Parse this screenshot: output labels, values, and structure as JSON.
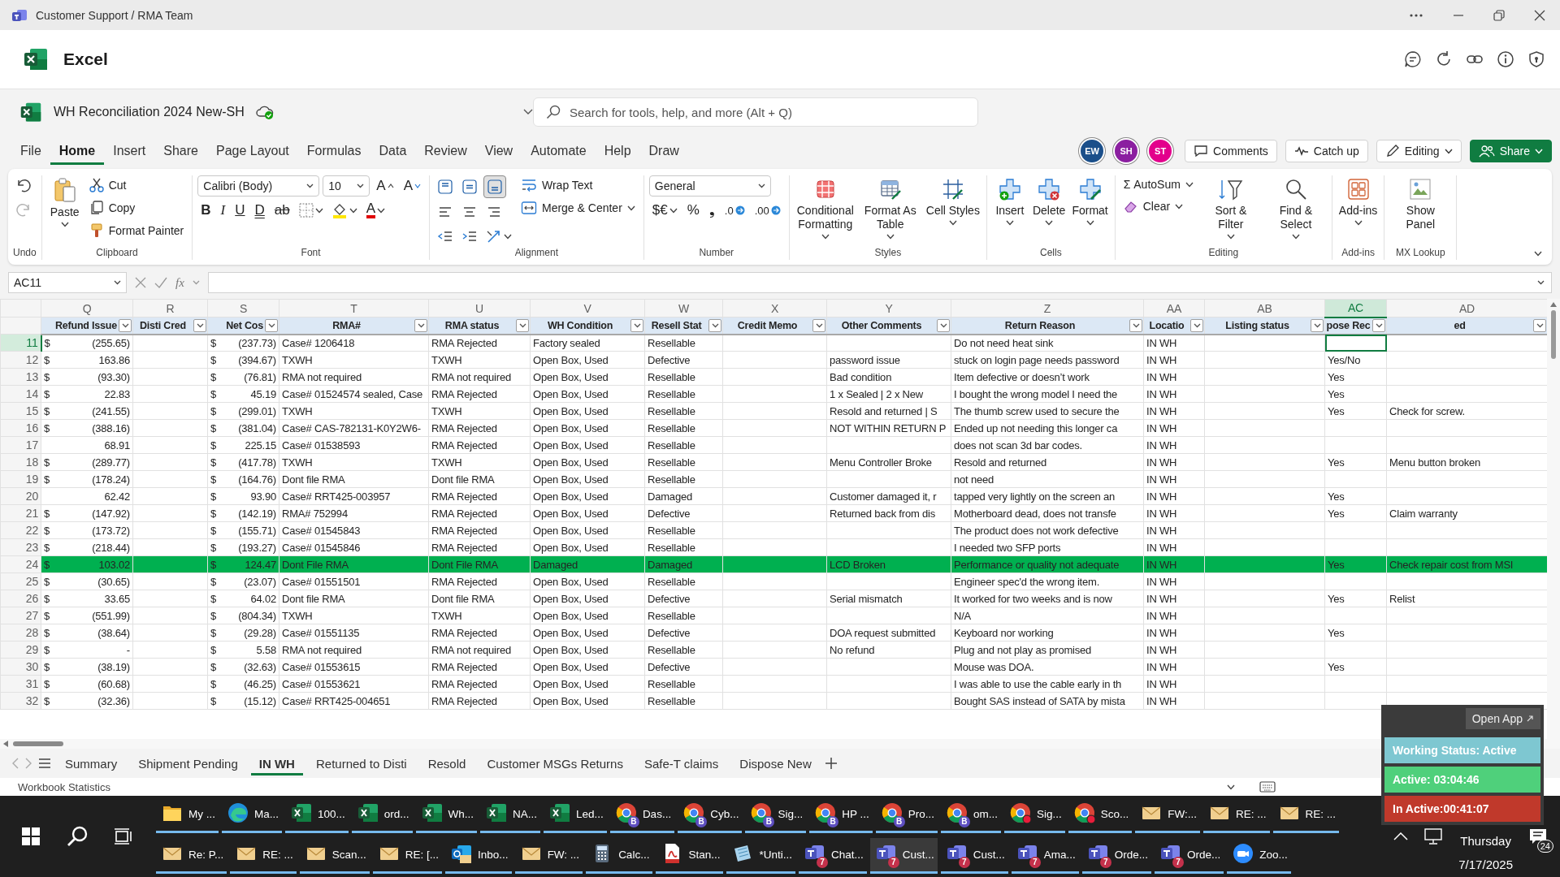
{
  "title_bar": {
    "title": "Customer Support / RMA Team"
  },
  "app_header": {
    "app_name": "Excel"
  },
  "document": {
    "name": "WH Reconciliation 2024 New-SH",
    "search": {
      "placeholder": "Search for tools, help, and more (Alt + Q)"
    }
  },
  "menu_tabs": [
    {
      "label": "File",
      "selected": false
    },
    {
      "label": "Home",
      "selected": true
    },
    {
      "label": "Insert",
      "selected": false
    },
    {
      "label": "Share",
      "selected": false
    },
    {
      "label": "Page Layout",
      "selected": false
    },
    {
      "label": "Formulas",
      "selected": false
    },
    {
      "label": "Data",
      "selected": false
    },
    {
      "label": "Review",
      "selected": false
    },
    {
      "label": "View",
      "selected": false
    },
    {
      "label": "Automate",
      "selected": false
    },
    {
      "label": "Help",
      "selected": false
    },
    {
      "label": "Draw",
      "selected": false
    }
  ],
  "collaborators": [
    {
      "initials": "EW",
      "color": "#1b4f8a"
    },
    {
      "initials": "SH",
      "color": "#8b1fa0"
    },
    {
      "initials": "ST",
      "color": "#e3008c"
    }
  ],
  "header_buttons": [
    {
      "label": "Comments",
      "kind": "comments"
    },
    {
      "label": "Catch up",
      "kind": "catchup"
    },
    {
      "label": "Editing",
      "kind": "editing"
    },
    {
      "label": "Share",
      "kind": "share"
    }
  ],
  "ribbon": {
    "groups": [
      {
        "label": "Undo",
        "columns": [
          [
            {
              "kind": "icon",
              "disabled": false
            },
            {
              "kind": "icon",
              "disabled": true
            }
          ]
        ]
      },
      {
        "label": "Clipboard",
        "columns": [
          [
            {
              "kind": "large",
              "label": "Paste",
              "dropdown": true
            }
          ],
          [
            {
              "kind": "small",
              "label": "Cut"
            },
            {
              "kind": "small",
              "label": "Copy"
            },
            {
              "kind": "small",
              "label": "Format Painter"
            }
          ]
        ]
      },
      {
        "label": "Font",
        "columns": [
          [
            {
              "kind": "line",
              "items": [
                {
                  "kind": "select",
                  "value": "Calibri (Body)"
                },
                {
                  "kind": "select",
                  "value": "10"
                },
                {
                  "kind": "glyph",
                  "label": "A"
                },
                {
                  "kind": "glyph",
                  "label": "A"
                }
              ]
            },
            {
              "kind": "line",
              "items": [
                {
                  "kind": "glyph",
                  "label": "B"
                },
                {
                  "kind": "glyph",
                  "label": "I"
                },
                {
                  "kind": "glyph",
                  "label": "U"
                },
                {
                  "kind": "glyph",
                  "label": "D"
                },
                {
                  "kind": "glyph",
                  "label": "ab"
                },
                {
                  "kind": "icon",
                  "dropdown": true
                },
                {
                  "kind": "icon",
                  "dropdown": true
                },
                {
                  "kind": "glyph",
                  "label": "A",
                  "dropdown": true
                }
              ]
            }
          ]
        ]
      },
      {
        "label": "Alignment",
        "columns": [
          [
            {
              "kind": "line",
              "items": [
                {
                  "kind": "icon",
                  "selected": false
                },
                {
                  "kind": "icon",
                  "selected": false
                },
                {
                  "kind": "icon",
                  "selected": true
                }
              ]
            },
            {
              "kind": "line",
              "items": [
                {
                  "kind": "icon"
                },
                {
                  "kind": "icon"
                },
                {
                  "kind": "icon"
                }
              ]
            },
            {
              "kind": "line",
              "items": [
                {
                  "kind": "icon"
                },
                {
                  "kind": "icon"
                },
                {
                  "kind": "icon",
                  "dropdown": true
                }
              ]
            }
          ],
          [
            {
              "kind": "small",
              "label": "Wrap Text"
            },
            {
              "kind": "small",
              "label": "Merge & Center",
              "dropdown": true
            }
          ]
        ]
      },
      {
        "label": "Number",
        "columns": [
          [
            {
              "kind": "select",
              "value": "General"
            },
            {
              "kind": "line",
              "items": [
                {
                  "kind": "glyph",
                  "label": "$€",
                  "dropdown": true
                },
                {
                  "kind": "glyph",
                  "label": "%"
                },
                {
                  "kind": "glyph",
                  "label": "❟"
                },
                {
                  "kind": "glyph",
                  "label": ".0"
                },
                {
                  "kind": "glyph",
                  "label": ".00"
                }
              ]
            }
          ]
        ]
      },
      {
        "label": "Styles",
        "columns": [
          [
            {
              "kind": "large",
              "label": "Conditional Formatting",
              "dropdown": true
            }
          ],
          [
            {
              "kind": "large",
              "label": "Format As Table",
              "dropdown": true
            }
          ],
          [
            {
              "kind": "large",
              "label": "Cell Styles",
              "dropdown": true
            }
          ]
        ]
      },
      {
        "label": "Cells",
        "columns": [
          [
            {
              "kind": "large",
              "label": "Insert",
              "dropdown": true
            }
          ],
          [
            {
              "kind": "large",
              "label": "Delete",
              "dropdown": true
            }
          ],
          [
            {
              "kind": "large",
              "label": "Format",
              "dropdown": true
            }
          ]
        ]
      },
      {
        "label": "Editing",
        "columns": [
          [
            {
              "kind": "small",
              "label": "AutoSum",
              "glyph": "Σ",
              "dropdown": true
            },
            {
              "kind": "small",
              "label": "Clear",
              "dropdown": true
            }
          ],
          [
            {
              "kind": "large",
              "label": "Sort & Filter",
              "dropdown": true
            }
          ],
          [
            {
              "kind": "large",
              "label": "Find & Select",
              "dropdown": true
            }
          ]
        ]
      },
      {
        "label": "Add-ins",
        "columns": [
          [
            {
              "kind": "large",
              "label": "Add-ins",
              "dropdown": true
            }
          ]
        ]
      },
      {
        "label": "MX Lookup",
        "columns": [
          [
            {
              "kind": "large",
              "label": "Show Panel"
            }
          ]
        ]
      }
    ]
  },
  "formula_bar": {
    "name_box": "AC11",
    "function_label": "fx"
  },
  "sheet": {
    "columns": [
      {
        "letter": "Q",
        "header": "Refund Issue",
        "kind": "money",
        "selected": false
      },
      {
        "letter": "R",
        "header": "Disti Cred",
        "kind": "text",
        "selected": false
      },
      {
        "letter": "S",
        "header": "Net Cos",
        "kind": "money",
        "selected": false
      },
      {
        "letter": "T",
        "header": "RMA#",
        "kind": "text",
        "selected": false
      },
      {
        "letter": "U",
        "header": "RMA status",
        "kind": "text",
        "selected": false
      },
      {
        "letter": "V",
        "header": "WH Condition",
        "kind": "text",
        "selected": false
      },
      {
        "letter": "W",
        "header": "Resell Stat",
        "kind": "text",
        "selected": false
      },
      {
        "letter": "X",
        "header": "Credit Memo",
        "kind": "text",
        "selected": false
      },
      {
        "letter": "Y",
        "header": "Other Comments",
        "kind": "text",
        "selected": false
      },
      {
        "letter": "Z",
        "header": "Return Reason",
        "kind": "text",
        "selected": false
      },
      {
        "letter": "AA",
        "header": "Locatio",
        "kind": "text",
        "selected": false
      },
      {
        "letter": "AB",
        "header": "Listing status",
        "kind": "text",
        "selected": false
      },
      {
        "letter": "AC",
        "header": "pose Rec",
        "kind": "text",
        "selected": true
      },
      {
        "letter": "AD",
        "header": "ed",
        "kind": "text",
        "selected": false
      }
    ],
    "rows": [
      {
        "number": "11",
        "selected": true,
        "highlight": false,
        "cells": [
          {
            "sign": "$",
            "value": "(255.65)"
          },
          null,
          {
            "sign": "$",
            "value": "(237.73)"
          },
          "Case# 1206418",
          "RMA Rejected",
          "Factory sealed",
          "Resellable",
          null,
          null,
          "Do not need heat sink",
          "IN WH",
          null,
          null,
          null
        ]
      },
      {
        "number": "12",
        "selected": false,
        "highlight": false,
        "cells": [
          {
            "sign": "$",
            "value": "163.86"
          },
          null,
          {
            "sign": "$",
            "value": "(394.67)"
          },
          "TXWH",
          "TXWH",
          "Open Box, Used",
          "Defective",
          null,
          "password issue",
          "stuck on login page needs password",
          "IN WH",
          null,
          "Yes/No",
          null
        ]
      },
      {
        "number": "13",
        "selected": false,
        "highlight": false,
        "cells": [
          {
            "sign": "$",
            "value": "(93.30)"
          },
          null,
          {
            "sign": "$",
            "value": "(76.81)"
          },
          "RMA not required",
          "RMA not required",
          "Open Box, Used",
          "Resellable",
          null,
          "Bad condition",
          "Item defective or doesn’t work",
          "IN WH",
          null,
          "Yes",
          null
        ]
      },
      {
        "number": "14",
        "selected": false,
        "highlight": false,
        "cells": [
          {
            "sign": "$",
            "value": "22.83"
          },
          null,
          {
            "sign": "$",
            "value": "45.19"
          },
          "Case# 01524574 sealed, Case",
          "RMA Rejected",
          "Open Box, Used",
          "Resellable",
          null,
          "1 x Sealed | 2 x New",
          "I bought the wrong model I need the",
          "IN WH",
          null,
          "Yes",
          null
        ]
      },
      {
        "number": "15",
        "selected": false,
        "highlight": false,
        "cells": [
          {
            "sign": "$",
            "value": "(241.55)"
          },
          null,
          {
            "sign": "$",
            "value": "(299.01)"
          },
          "TXWH",
          "TXWH",
          "Open Box, Used",
          "Resellable",
          null,
          "Resold and returned | S",
          "The thumb screw used to secure the",
          "IN WH",
          null,
          "Yes",
          "Check for screw."
        ]
      },
      {
        "number": "16",
        "selected": false,
        "highlight": false,
        "cells": [
          {
            "sign": "$",
            "value": "(388.16)"
          },
          null,
          {
            "sign": "$",
            "value": "(381.04)"
          },
          "Case# CAS-782131-K0Y2W6-",
          "RMA Rejected",
          "Open Box, Used",
          "Resellable",
          null,
          "NOT WITHIN RETURN P",
          "Ended up not needing this longer ca",
          "IN WH",
          null,
          null,
          null
        ]
      },
      {
        "number": "17",
        "selected": false,
        "highlight": false,
        "cells": [
          {
            "value": "68.91"
          },
          null,
          {
            "sign": "$",
            "value": "225.15"
          },
          "Case# 01538593",
          "RMA Rejected",
          "Open Box, Used",
          "Resellable",
          null,
          null,
          "does not scan 3d bar codes.",
          "IN WH",
          null,
          null,
          null
        ]
      },
      {
        "number": "18",
        "selected": false,
        "highlight": false,
        "cells": [
          {
            "sign": "$",
            "value": "(289.77)"
          },
          null,
          {
            "sign": "$",
            "value": "(417.78)"
          },
          "TXWH",
          "TXWH",
          "Open Box, Used",
          "Resellable",
          null,
          "Menu Controller Broke",
          "Resold and returned",
          "IN WH",
          null,
          "Yes",
          "Menu button broken"
        ]
      },
      {
        "number": "19",
        "selected": false,
        "highlight": false,
        "cells": [
          {
            "sign": "$",
            "value": "(178.24)"
          },
          null,
          {
            "sign": "$",
            "value": "(164.76)"
          },
          "Dont file RMA",
          "Dont file RMA",
          "Open Box, Used",
          "Resellable",
          null,
          null,
          "not need",
          "IN WH",
          null,
          null,
          null
        ]
      },
      {
        "number": "20",
        "selected": false,
        "highlight": false,
        "cells": [
          {
            "value": "62.42"
          },
          null,
          {
            "sign": "$",
            "value": "93.90"
          },
          "Case# RRT425-003957",
          "RMA Rejected",
          "Open Box, Used",
          "Damaged",
          null,
          "Customer damaged it, r",
          "tapped very lightly on the screen an",
          "IN WH",
          null,
          "Yes",
          null
        ]
      },
      {
        "number": "21",
        "selected": false,
        "highlight": false,
        "cells": [
          {
            "sign": "$",
            "value": "(147.92)"
          },
          null,
          {
            "sign": "$",
            "value": "(142.19)"
          },
          "RMA# 752994",
          "RMA Rejected",
          "Open Box, Used",
          "Defective",
          null,
          "Returned back from dis",
          "Motherboard dead, does not transfe",
          "IN WH",
          null,
          "Yes",
          "Claim warranty"
        ]
      },
      {
        "number": "22",
        "selected": false,
        "highlight": false,
        "cells": [
          {
            "sign": "$",
            "value": "(173.72)"
          },
          null,
          {
            "sign": "$",
            "value": "(155.71)"
          },
          "Case# 01545843",
          "RMA Rejected",
          "Open Box, Used",
          "Resellable",
          null,
          null,
          "The product does not work defective",
          "IN WH",
          null,
          null,
          null
        ]
      },
      {
        "number": "23",
        "selected": false,
        "highlight": false,
        "cells": [
          {
            "sign": "$",
            "value": "(218.44)"
          },
          null,
          {
            "sign": "$",
            "value": "(193.27)"
          },
          "Case# 01545846",
          "RMA Rejected",
          "Open Box, Used",
          "Resellable",
          null,
          null,
          "I needed two SFP ports",
          "IN WH",
          null,
          null,
          null
        ]
      },
      {
        "number": "24",
        "selected": false,
        "highlight": true,
        "cells": [
          {
            "sign": "$",
            "value": "103.02"
          },
          null,
          {
            "sign": "$",
            "value": "124.47"
          },
          "Dont File RMA",
          "Dont File RMA",
          "Damaged",
          "Damaged",
          null,
          "LCD Broken",
          "Performance or quality not adequate",
          "IN WH",
          null,
          "Yes",
          "Check repair cost from MSI"
        ]
      },
      {
        "number": "25",
        "selected": false,
        "highlight": false,
        "cells": [
          {
            "sign": "$",
            "value": "(30.65)"
          },
          null,
          {
            "sign": "$",
            "value": "(23.07)"
          },
          "Case# 01551501",
          "RMA Rejected",
          "Open Box, Used",
          "Resellable",
          null,
          null,
          "Engineer spec'd the wrong item.",
          "IN WH",
          null,
          null,
          null
        ]
      },
      {
        "number": "26",
        "selected": false,
        "highlight": false,
        "cells": [
          {
            "sign": "$",
            "value": "33.65"
          },
          null,
          {
            "sign": "$",
            "value": "64.02"
          },
          "Dont file RMA",
          "Dont file RMA",
          "Open Box, Used",
          "Defective",
          null,
          "Serial mismatch",
          "It worked for two weeks and is now",
          "IN WH",
          null,
          "Yes",
          "Relist"
        ]
      },
      {
        "number": "27",
        "selected": false,
        "highlight": false,
        "cells": [
          {
            "sign": "$",
            "value": "(551.99)"
          },
          null,
          {
            "sign": "$",
            "value": "(804.34)"
          },
          "TXWH",
          "TXWH",
          "Open Box, Used",
          "Resellable",
          null,
          null,
          "N/A",
          "IN WH",
          null,
          null,
          null
        ]
      },
      {
        "number": "28",
        "selected": false,
        "highlight": false,
        "cells": [
          {
            "sign": "$",
            "value": "(38.64)"
          },
          null,
          {
            "sign": "$",
            "value": "(29.28)"
          },
          "Case# 01551135",
          "RMA Rejected",
          "Open Box, Used",
          "Defective",
          null,
          "DOA request submitted",
          "Keyboard nor working",
          "IN WH",
          null,
          "Yes",
          null
        ]
      },
      {
        "number": "29",
        "selected": false,
        "highlight": false,
        "cells": [
          {
            "sign": "$",
            "value": "-"
          },
          null,
          {
            "sign": "$",
            "value": "5.58"
          },
          "RMA not required",
          "RMA not required",
          "Open Box, Used",
          "Resellable",
          null,
          "No refund",
          "Plug and not play as promised",
          "IN WH",
          null,
          null,
          null
        ]
      },
      {
        "number": "30",
        "selected": false,
        "highlight": false,
        "cells": [
          {
            "sign": "$",
            "value": "(38.19)"
          },
          null,
          {
            "sign": "$",
            "value": "(32.63)"
          },
          "Case# 01553615",
          "RMA Rejected",
          "Open Box, Used",
          "Defective",
          null,
          null,
          "Mouse was DOA.",
          "IN WH",
          null,
          "Yes",
          null
        ]
      },
      {
        "number": "31",
        "selected": false,
        "highlight": false,
        "cells": [
          {
            "sign": "$",
            "value": "(60.68)"
          },
          null,
          {
            "sign": "$",
            "value": "(46.25)"
          },
          "Case# 01553621",
          "RMA Rejected",
          "Open Box, Used",
          "Resellable",
          null,
          null,
          "I was able to use the cable early in th",
          "IN WH",
          null,
          null,
          null
        ]
      },
      {
        "number": "32",
        "selected": false,
        "highlight": false,
        "cells": [
          {
            "sign": "$",
            "value": "(32.36)"
          },
          null,
          {
            "sign": "$",
            "value": "(15.12)"
          },
          "Case# RRT425-004651",
          "RMA Rejected",
          "Open Box, Used",
          "Resellable",
          null,
          null,
          "Bought SAS instead of SATA by mista",
          "IN WH",
          null,
          null,
          null
        ]
      }
    ]
  },
  "sheet_tabs": [
    {
      "label": "Summary",
      "selected": false
    },
    {
      "label": "Shipment Pending",
      "selected": false
    },
    {
      "label": "IN WH",
      "selected": true
    },
    {
      "label": "Returned to Disti",
      "selected": false
    },
    {
      "label": "Resold",
      "selected": false
    },
    {
      "label": "Customer MSGs Returns",
      "selected": false
    },
    {
      "label": "Safe-T claims",
      "selected": false
    },
    {
      "label": "Dispose New",
      "selected": false
    }
  ],
  "status_bar": {
    "text": "Workbook Statistics"
  },
  "overlay": {
    "button": "Open App",
    "status": "Working Status: Active",
    "active": "Active: 03:04:46",
    "inactive": "In Active:00:41:07"
  },
  "taskbar": {
    "top_row": [
      {
        "label": "My ...",
        "kind": "folder",
        "selected": false
      },
      {
        "label": "Ma...",
        "kind": "edge",
        "selected": false
      },
      {
        "label": "100...",
        "kind": "excel",
        "selected": false
      },
      {
        "label": "ord...",
        "kind": "excel",
        "selected": false
      },
      {
        "label": "Wh...",
        "kind": "excel",
        "selected": false
      },
      {
        "label": "NA...",
        "kind": "excel",
        "selected": false
      },
      {
        "label": "Led...",
        "kind": "excel",
        "selected": false
      },
      {
        "label": "Das...",
        "kind": "chrome",
        "badge": "B",
        "selected": false
      },
      {
        "label": "Cyb...",
        "kind": "chrome",
        "badge": "B",
        "selected": false
      },
      {
        "label": "Sig...",
        "kind": "chrome",
        "badge": "B",
        "selected": false
      },
      {
        "label": "HP ...",
        "kind": "chrome",
        "badge": "B",
        "selected": false
      },
      {
        "label": "Pro...",
        "kind": "chrome",
        "badge": "B",
        "selected": false
      },
      {
        "label": "om...",
        "kind": "chrome",
        "badge": "B",
        "selected": false
      },
      {
        "label": "Sig...",
        "kind": "chrome-alert",
        "selected": false
      },
      {
        "label": "Sco...",
        "kind": "chrome-alert",
        "selected": false
      },
      {
        "label": "FW:...",
        "kind": "mail",
        "selected": false
      },
      {
        "label": "RE: ...",
        "kind": "mail",
        "selected": false
      },
      {
        "label": "RE: ...",
        "kind": "mail",
        "selected": false
      }
    ],
    "bottom_row": [
      {
        "label": "Re: P...",
        "kind": "mail",
        "selected": false
      },
      {
        "label": "RE: ...",
        "kind": "mail",
        "selected": false
      },
      {
        "label": "Scan...",
        "kind": "mail",
        "selected": false
      },
      {
        "label": "RE: [...",
        "kind": "mail",
        "selected": false
      },
      {
        "label": "Inbo...",
        "kind": "outlook",
        "selected": false
      },
      {
        "label": "FW: ...",
        "kind": "mail",
        "selected": false
      },
      {
        "label": "Calc...",
        "kind": "calculator",
        "selected": false
      },
      {
        "label": "Stan...",
        "kind": "pdf",
        "selected": false
      },
      {
        "label": "*Unti...",
        "kind": "editor",
        "selected": false
      },
      {
        "label": "Chat...",
        "kind": "teams",
        "badge": "7",
        "selected": false
      },
      {
        "label": "Cust...",
        "kind": "teams",
        "badge": "7",
        "selected": true
      },
      {
        "label": "Cust...",
        "kind": "teams",
        "badge": "7",
        "selected": false
      },
      {
        "label": "Ama...",
        "kind": "teams",
        "badge": "7",
        "selected": false
      },
      {
        "label": "Orde...",
        "kind": "teams",
        "badge": "7",
        "selected": false
      },
      {
        "label": "Orde...",
        "kind": "teams",
        "badge": "7",
        "selected": false
      },
      {
        "label": "Zoo...",
        "kind": "zoom",
        "selected": false
      }
    ],
    "clock": {
      "day": "Thursday",
      "date": "7/17/2025"
    },
    "notifications": "24"
  }
}
